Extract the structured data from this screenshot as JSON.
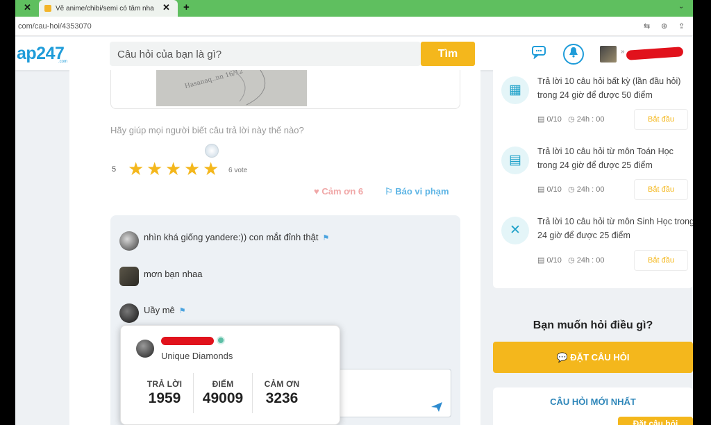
{
  "browser": {
    "tab_title": "Vẽ anime/chibi/semi có tâm nha",
    "close_glyph": "✕",
    "new_tab_glyph": "+",
    "url": "com/cau-hoi/4353070"
  },
  "header": {
    "logo": "ap247",
    "logo_sub": ".com",
    "search_placeholder": "Câu hỏi của bạn là gì?",
    "search_button": "Tìm"
  },
  "question": {
    "photo_text": "Hasanaq..nn 16/12",
    "rating_prompt": "Hãy giúp mọi người biết câu trả lời này thế nào?",
    "rating_value": "5",
    "stars": 5,
    "votes": "6 vote",
    "thanks": "♥ Cảm ơn 6",
    "report": "⚐ Báo vi phạm"
  },
  "comments": [
    {
      "text": "nhìn khá giống yandere:)) con mắt đỉnh thật",
      "flag": "⚑"
    },
    {
      "text": "mơn bạn nhaa",
      "flag": ""
    },
    {
      "text": "Uầy mê",
      "flag": "⚑"
    }
  ],
  "profile_popup": {
    "rank": "Unique Diamonds",
    "stats": [
      {
        "label": "TRẢ LỜI",
        "value": "1959"
      },
      {
        "label": "ĐIỂM",
        "value": "49009"
      },
      {
        "label": "CẢM ƠN",
        "value": "3236"
      }
    ]
  },
  "tasks": [
    {
      "title": "Trả lời 10 câu hỏi  bất kỳ (lần đầu hỏi) trong 24 giờ để được 50 điểm",
      "progress": "0/10",
      "time": "24h : 00",
      "button": "Bắt đầu",
      "icon": "grid-icon",
      "glyph": "▦"
    },
    {
      "title": "Trả lời 10 câu hỏi  từ môn Toán Học trong 24 giờ để được 25 điểm",
      "progress": "0/10",
      "time": "24h : 00",
      "button": "Bắt đầu",
      "icon": "calculator-icon",
      "glyph": "▤"
    },
    {
      "title": "Trả lời 10 câu hỏi  từ môn Sinh Học trong 24 giờ để được 25 điểm",
      "progress": "0/10",
      "time": "24h : 00",
      "button": "Bắt đầu",
      "icon": "dna-icon",
      "glyph": "✕"
    }
  ],
  "sidebar": {
    "ask_prompt": "Bạn muốn hỏi điều gì?",
    "ask_button": "ĐẶT CÂU HỎI",
    "new_questions_title": "CÂU HỎI MỚI NHẤT",
    "new_questions_button": "Đặt câu hỏi"
  },
  "colors": {
    "brand_blue": "#1f9cd9",
    "accent_yellow": "#f4b71c",
    "tab_bar_green": "#5fbf5f"
  }
}
